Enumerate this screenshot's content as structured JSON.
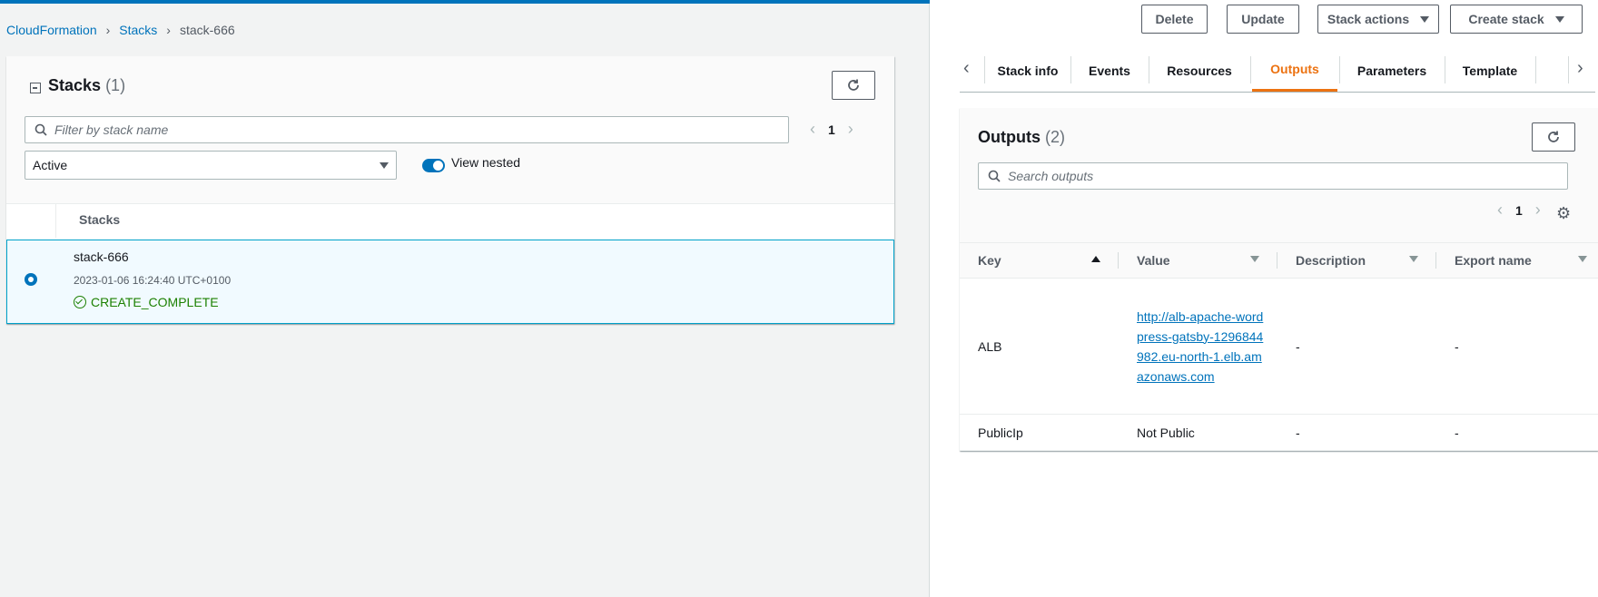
{
  "breadcrumb": {
    "items": [
      "CloudFormation",
      "Stacks"
    ],
    "current": "stack-666"
  },
  "stacks_panel": {
    "title": "Stacks",
    "count": "(1)",
    "search_placeholder": "Filter by stack name",
    "page": "1",
    "filter_value": "Active",
    "view_nested_label": "View nested",
    "view_nested_on": true,
    "column_header": "Stacks",
    "rows": [
      {
        "name": "stack-666",
        "created": "2023-01-06 16:24:40 UTC+0100",
        "status": "CREATE_COMPLETE",
        "selected": true
      }
    ]
  },
  "actions": {
    "delete": "Delete",
    "update": "Update",
    "stack_actions": "Stack actions",
    "create_stack": "Create stack"
  },
  "tabs": [
    "Stack info",
    "Events",
    "Resources",
    "Outputs",
    "Parameters",
    "Template"
  ],
  "active_tab": "Outputs",
  "outputs_panel": {
    "title": "Outputs",
    "count": "(2)",
    "search_placeholder": "Search outputs",
    "page": "1",
    "columns": [
      "Key",
      "Value",
      "Description",
      "Export name"
    ],
    "rows": [
      {
        "key": "ALB",
        "value": "http://alb-apache-wordpress-gatsby-1296844982.eu-north-1.elb.amazonaws.com",
        "value_is_link": true,
        "description": "-",
        "export": "-"
      },
      {
        "key": "PublicIp",
        "value": "Not Public",
        "value_is_link": false,
        "description": "-",
        "export": "-"
      }
    ]
  },
  "colors": {
    "link": "#0073bb",
    "accent_tab": "#ec7211",
    "success": "#1d8102"
  },
  "icons": [
    "refresh-icon",
    "search-icon",
    "settings-icon",
    "success-icon",
    "chevron-left-icon",
    "chevron-right-icon",
    "collapse-icon"
  ]
}
